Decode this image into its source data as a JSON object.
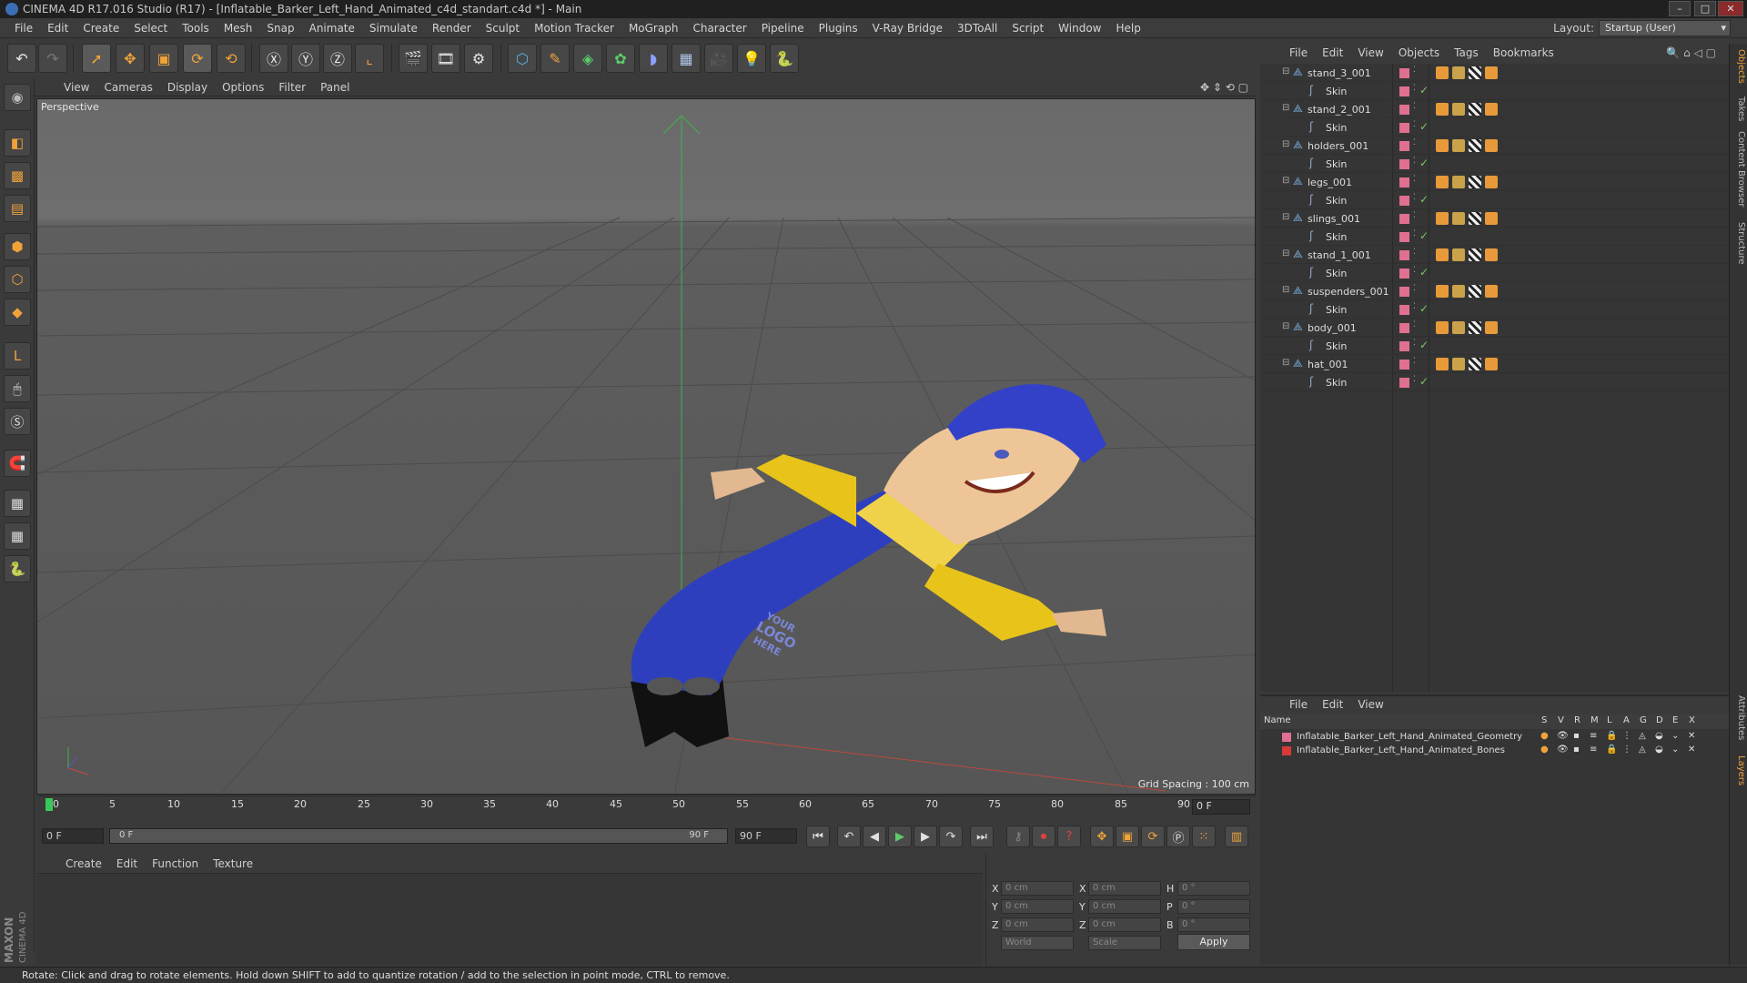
{
  "window": {
    "title": "CINEMA 4D R17.016 Studio (R17) - [Inflatable_Barker_Left_Hand_Animated_c4d_standart.c4d *] - Main"
  },
  "menubar": {
    "items": [
      "File",
      "Edit",
      "Create",
      "Select",
      "Tools",
      "Mesh",
      "Snap",
      "Animate",
      "Simulate",
      "Render",
      "Sculpt",
      "Motion Tracker",
      "MoGraph",
      "Character",
      "Pipeline",
      "Plugins",
      "V-Ray Bridge",
      "3DToAll",
      "Script",
      "Window",
      "Help"
    ],
    "layout_label": "Layout:",
    "layout_value": "Startup (User)"
  },
  "viewport": {
    "menu": [
      "View",
      "Cameras",
      "Display",
      "Options",
      "Filter",
      "Panel"
    ],
    "label": "Perspective",
    "grid_spacing": "Grid Spacing : 100 cm",
    "logo_text": [
      "YOUR",
      "LOGO",
      "HERE"
    ]
  },
  "timeline": {
    "ticks": [
      "0",
      "5",
      "10",
      "15",
      "20",
      "25",
      "30",
      "35",
      "40",
      "45",
      "50",
      "55",
      "60",
      "65",
      "70",
      "75",
      "80",
      "85",
      "90"
    ],
    "current_frame": "0 F",
    "start_field": "0 F",
    "range_start": "0 F",
    "range_end": "90 F",
    "end_field": "90 F"
  },
  "material_manager": {
    "menu": [
      "Create",
      "Edit",
      "Function",
      "Texture"
    ]
  },
  "coordinates": {
    "rows": [
      {
        "l1": "X",
        "v1": "0 cm",
        "l2": "X",
        "v2": "0 cm",
        "l3": "H",
        "v3": "0 °"
      },
      {
        "l1": "Y",
        "v1": "0 cm",
        "l2": "Y",
        "v2": "0 cm",
        "l3": "P",
        "v3": "0 °"
      },
      {
        "l1": "Z",
        "v1": "0 cm",
        "l2": "Z",
        "v2": "0 cm",
        "l3": "B",
        "v3": "0 °"
      }
    ],
    "mode1": "World",
    "mode2": "Scale",
    "apply": "Apply"
  },
  "object_manager": {
    "menu": [
      "File",
      "Edit",
      "View",
      "Objects",
      "Tags",
      "Bookmarks"
    ],
    "objects": [
      {
        "name": "stand_3_001",
        "child": "Skin"
      },
      {
        "name": "stand_2_001",
        "child": "Skin"
      },
      {
        "name": "holders_001",
        "child": "Skin"
      },
      {
        "name": "legs_001",
        "child": "Skin"
      },
      {
        "name": "slings_001",
        "child": "Skin"
      },
      {
        "name": "stand_1_001",
        "child": "Skin"
      },
      {
        "name": "suspenders_001",
        "child": "Skin"
      },
      {
        "name": "body_001",
        "child": "Skin"
      },
      {
        "name": "hat_001",
        "child": "Skin"
      }
    ]
  },
  "layer_manager": {
    "menu": [
      "File",
      "Edit",
      "View"
    ],
    "header_name": "Name",
    "columns": [
      "S",
      "V",
      "R",
      "M",
      "L",
      "A",
      "G",
      "D",
      "E",
      "X"
    ],
    "layers": [
      {
        "name": "Inflatable_Barker_Left_Hand_Animated_Geometry",
        "color": "#e07090"
      },
      {
        "name": "Inflatable_Barker_Left_Hand_Animated_Bones",
        "color": "#d83a3a"
      }
    ]
  },
  "right_tabs": [
    "Objects",
    "Takes",
    "Content Browser",
    "Structure",
    "Attributes",
    "Layers"
  ],
  "status": "Rotate: Click and drag to rotate elements. Hold down SHIFT to add to quantize rotation / add to the selection in point mode, CTRL to remove.",
  "brand": [
    "MAXON",
    "CINEMA 4D"
  ]
}
